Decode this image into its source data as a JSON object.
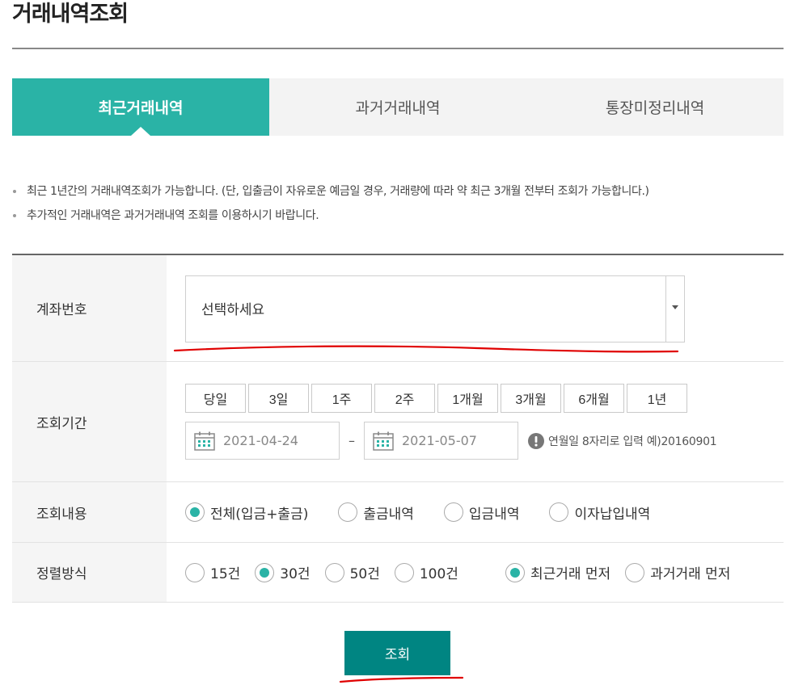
{
  "page": {
    "title": "거래내역조회"
  },
  "tabs": [
    {
      "label": "최근거래내역",
      "active": true
    },
    {
      "label": "과거거래내역",
      "active": false
    },
    {
      "label": "통장미정리내역",
      "active": false
    }
  ],
  "notices": [
    "최근 1년간의 거래내역조회가 가능합니다. (단, 입출금이 자유로운 예금일 경우, 거래량에 따라 약 최근 3개월 전부터 조회가 가능합니다.)",
    "추가적인 거래내역은 과거거래내역 조회를 이용하시기 바랍니다."
  ],
  "form": {
    "account": {
      "label": "계좌번호",
      "selected": "선택하세요"
    },
    "period": {
      "label": "조회기간",
      "buttons": [
        "당일",
        "3일",
        "1주",
        "2주",
        "1개월",
        "3개월",
        "6개월",
        "1년"
      ],
      "start_date": "2021-04-24",
      "separator": "–",
      "end_date": "2021-05-07",
      "hint": "연월일 8자리로 입력 예)20160901"
    },
    "content_type": {
      "label": "조회내용",
      "options": [
        {
          "label": "전체(입금+출금)",
          "checked": true
        },
        {
          "label": "출금내역",
          "checked": false
        },
        {
          "label": "입금내역",
          "checked": false
        },
        {
          "label": "이자납입내역",
          "checked": false
        }
      ]
    },
    "sort": {
      "label": "정렬방식",
      "count_options": [
        {
          "label": "15건",
          "checked": false
        },
        {
          "label": "30건",
          "checked": true
        },
        {
          "label": "50건",
          "checked": false
        },
        {
          "label": "100건",
          "checked": false
        }
      ],
      "order_options": [
        {
          "label": "최근거래 먼저",
          "checked": true
        },
        {
          "label": "과거거래 먼저",
          "checked": false
        }
      ]
    }
  },
  "actions": {
    "search_label": "조회"
  },
  "colors": {
    "accent": "#2ab3a6",
    "button": "#008582",
    "annotation": "#e00000"
  },
  "icons": {
    "calendar": "calendar-icon",
    "dropdown": "caret-down-icon",
    "hint": "exclamation-circle-icon"
  }
}
